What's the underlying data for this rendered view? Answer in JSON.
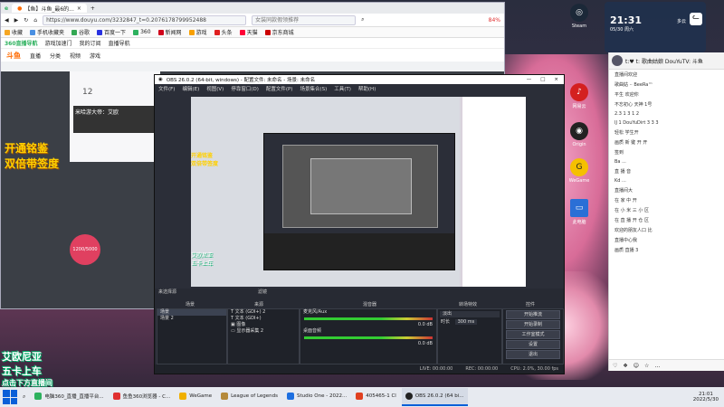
{
  "browser": {
    "tab_title": "【鱼】斗鱼_最6的...",
    "url": "https://www.douyu.com/3232847_t=0.2076178799952488",
    "search_text": "女装同款假领推荐",
    "percent": "84%",
    "bookmarks": [
      "收藏",
      "手机收藏夹",
      "谷歌",
      "百度一下",
      "360",
      "新闻网",
      "游戏",
      "头条",
      "天猫",
      "京东商城"
    ],
    "subnav": [
      "360直播导航",
      "游戏加速门",
      "我的订阅",
      "直播导航"
    ],
    "site_nav": [
      "斗鱼",
      "直播",
      "分类",
      "视频",
      "游戏"
    ],
    "room_count": "12",
    "streamer_label": "米哈游大帝：艾欧",
    "badge_text": "1200/5000",
    "overlay_orange": [
      "开通铭鉴",
      "双倍带签度"
    ]
  },
  "obs": {
    "title": "OBS 26.0.2 (64-bit, windows) - 配置文件: 未命名 - 场景: 未命名",
    "menu": [
      "文件(F)",
      "编辑(E)",
      "视图(V)",
      "停靠窗口(D)",
      "配置文件(P)",
      "场景集合(S)",
      "工具(T)",
      "帮助(H)"
    ],
    "panels": {
      "scenes": "场景",
      "sources": "来源",
      "mixer": "混音器",
      "transitions": "转场特效",
      "controls": "控件"
    },
    "scene_label": "来选择源",
    "filter_label": "滤镜",
    "scenes": [
      "场景",
      "场景 2"
    ],
    "sources": [
      "文本 (GDI+) 2",
      "文本 (GDI+)",
      "图像",
      "显示器采集 2"
    ],
    "mixer": [
      {
        "name": "麦克风/Aux",
        "db": "0.0 dB"
      },
      {
        "name": "桌面音频",
        "db": "0.0 dB"
      }
    ],
    "transition": {
      "type": "淡出",
      "duration_label": "时长",
      "duration": "300 ms"
    },
    "controls": [
      "开始推流",
      "开始录制",
      "工作室模式",
      "设置",
      "退出"
    ],
    "status": {
      "live": "LIVE: 00:00:00",
      "rec": "REC: 00:00:00",
      "cpu": "CPU: 2.0%, 30.00 fps"
    }
  },
  "widget": {
    "time": "21:31",
    "date": "05/30 周六",
    "weather": "多云"
  },
  "chat": {
    "header": "t:♥ t: 歌曲姑娘 DouYuTV: 斗鱼",
    "lines": [
      "直播间欢迎",
      "歌曲姑 ·· BeeRa™",
      "平生 欢迎你",
      "不忘初心 天神 1号",
      "2.3 1 3 1 2",
      "IJ 1 DouYuDirt 3 3 3",
      "轻松 学生开",
      "画质 新 键 开 开",
      "签到",
      "Ba ...",
      "直 播 音",
      "Kd ...",
      "直播间大",
      "在 家 中 开",
      "在 小 米 三 小 区",
      "在 直 播 开 仓 区",
      "欢迎的朋友人口 比",
      "直播中心我",
      "画质 直播 3"
    ],
    "footer_icons": [
      "heart-icon",
      "gift-icon",
      "person-icon",
      "star-icon",
      "more-icon"
    ]
  },
  "overlay": {
    "green_text": [
      "艾欧尼亚",
      "五卡上车",
      "点击下方直播间"
    ]
  },
  "desktop_icons": [
    {
      "label": "Steam",
      "color": "#1b2838"
    },
    {
      "label": "WeGame",
      "color": "#f5c000"
    },
    {
      "label": "Origin",
      "color": "#e85a1a"
    },
    {
      "label": "网易云",
      "color": "#d42020"
    },
    {
      "label": "此电脑",
      "color": "#2a6fd6"
    }
  ],
  "taskbar": {
    "apps": [
      {
        "label": "电脑360_直播_直播平台...",
        "color": "#2db15e"
      },
      {
        "label": "鱼鱼360浏览器 - C...",
        "color": "#e03030"
      },
      {
        "label": "WeGame",
        "color": "#f0b000"
      },
      {
        "label": "League of Legends",
        "color": "#b58a3a"
      },
      {
        "label": "Studio One - 2022...",
        "color": "#1d6fe0"
      },
      {
        "label": "405465-1 Cl",
        "color": "#e04020"
      },
      {
        "label": "OBS 26.0.2 (64 bi...",
        "color": "#222"
      }
    ],
    "time": "21:01",
    "date": "2022/5/30"
  },
  "colors": {
    "accent": "#ff6a00",
    "obs_bg": "#2b2e38",
    "taskbar": "#e7eaf0"
  }
}
